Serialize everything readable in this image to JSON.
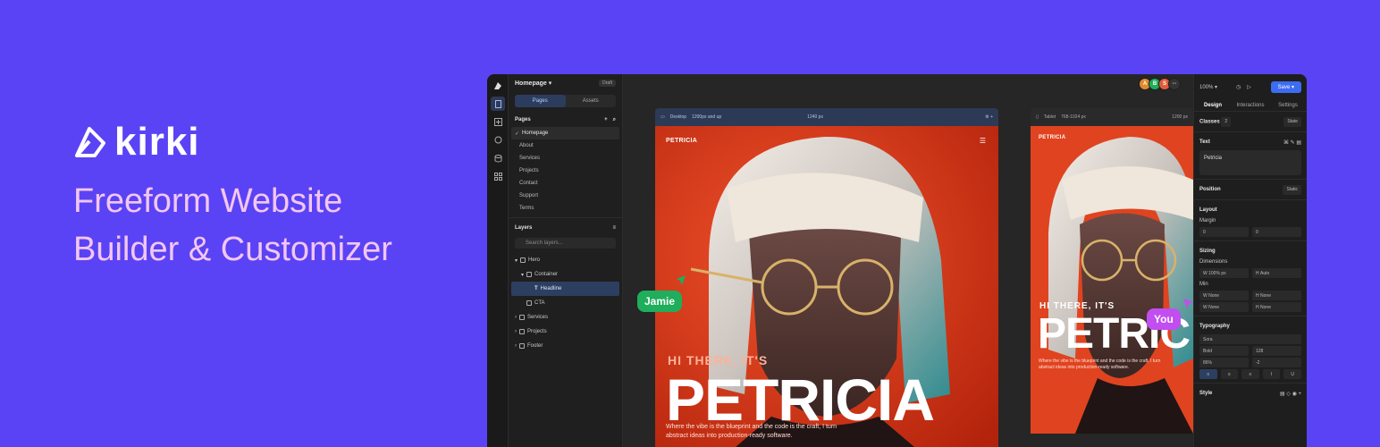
{
  "brand": {
    "name": "kirki",
    "tagline_line1": "Freeform Website",
    "tagline_line2": "Builder & Customizer"
  },
  "colors": {
    "background": "#5a43f4",
    "tagline": "#f3c6f1",
    "accent": "#3d6cf2",
    "jamie": "#1fae5b",
    "you": "#c24df0",
    "hero_bg": "#e53d1c"
  },
  "left_panel": {
    "page_name": "Homepage",
    "status_badge": "Draft",
    "tabs": [
      "Pages",
      "Assets"
    ],
    "pages_heading": "Pages",
    "pages": [
      "Homepage",
      "About",
      "Services",
      "Projects",
      "Contact",
      "Support",
      "Terms"
    ],
    "layers_heading": "Layers",
    "search_placeholder": "Search layers...",
    "layers": [
      "Hero",
      "Container",
      "Headline",
      "CTA",
      "Services",
      "Projects",
      "Footer"
    ]
  },
  "canvas": {
    "desktop_label": "Desktop",
    "desktop_size": "1200px and up",
    "desktop_width": "1240 px",
    "tablet_label": "Tablet",
    "tablet_size": "768-1024 px",
    "tablet_width": "1200 px",
    "site_logo": "PETRICIA",
    "hero_intro_hi": "HI THERE, IT'S",
    "hero_intro_hi_short": "HI THERE, IT'S",
    "hero_name": "PETRICIA",
    "hero_name_short": "PETRIC",
    "hero_copy_line1": "Where the vibe is the blueprint and the code is the craft, I turn",
    "hero_copy_line2": "abstract ideas into production-ready software.",
    "tablet_copy_line1": "Where the vibe is the blueprint and the code is the craft, I turn",
    "tablet_copy_line2": "abstract ideas into production-ready software.",
    "cursor_jamie": "Jamie",
    "cursor_you": "You"
  },
  "topbar": {
    "zoom": "100%",
    "save_label": "Save",
    "avatars": [
      "A",
      "B",
      "S"
    ],
    "more": "···"
  },
  "right_panel": {
    "tabs": [
      "Design",
      "Interactions",
      "Settings"
    ],
    "classes_label": "Classes",
    "classes_count": "2",
    "state_select": "State",
    "text_heading": "Text",
    "text_value": "Petricia",
    "position_heading": "Position",
    "position_value": "Static",
    "layout_heading": "Layout",
    "margin_label": "Margin",
    "margin_x": "0",
    "margin_y": "0",
    "sizing_heading": "Sizing",
    "dimensions_label": "Dimensions",
    "width_value": "100%",
    "height_value": "Auto",
    "min_label": "Min",
    "min_w": "None",
    "min_h": "None",
    "max_w": "None",
    "max_h": "None",
    "typography_heading": "Typography",
    "font_family": "Sora",
    "font_weight": "Bold",
    "font_size": "128",
    "line_height": "86%",
    "letter_spacing": "-2",
    "style_heading": "Style",
    "unit_px": "px",
    "w_prefix": "W",
    "h_prefix": "H"
  }
}
